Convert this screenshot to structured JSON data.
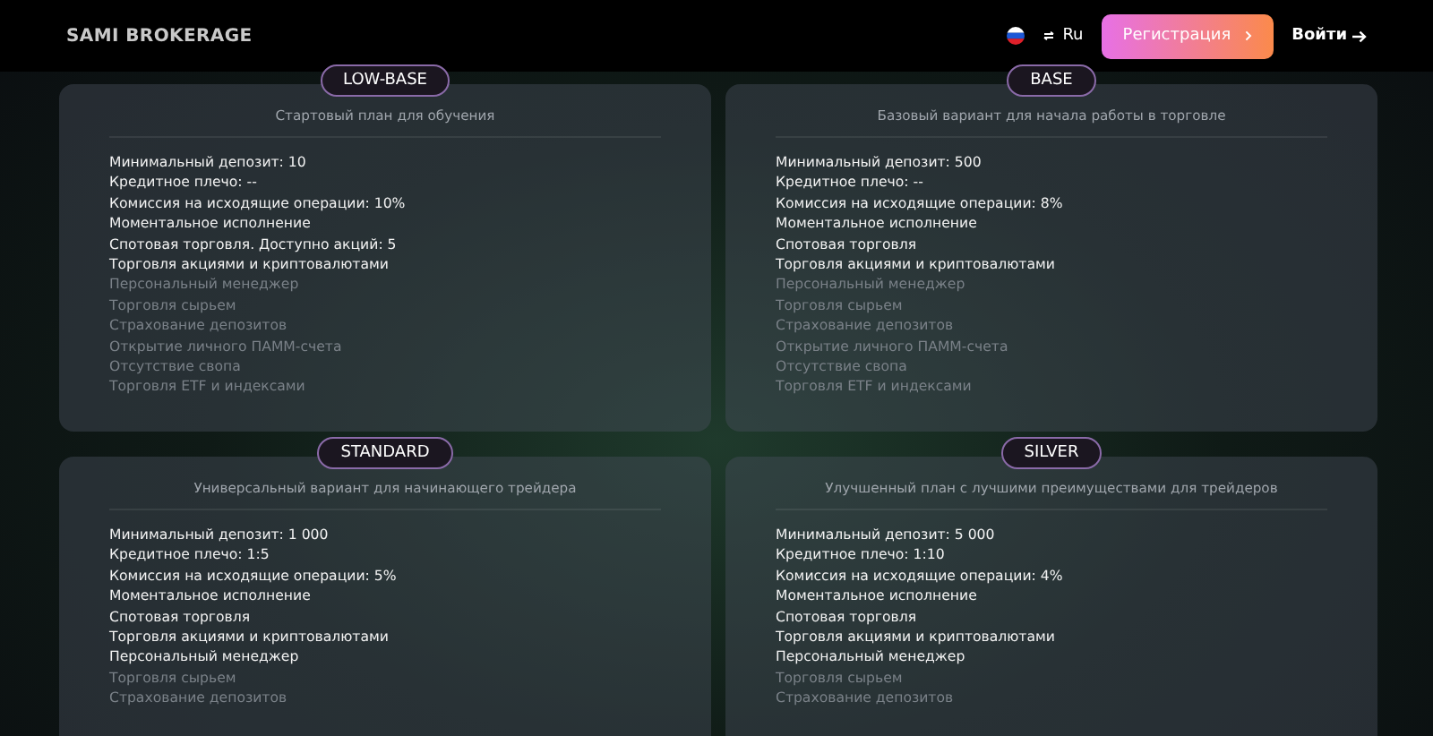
{
  "header": {
    "logo": "SAMI BROKERAGE",
    "language": "Ru",
    "register_button": "Регистрация",
    "login_link": "Войти"
  },
  "plans": [
    {
      "name": "LOW-BASE",
      "description": "Стартовый план для обучения",
      "features": [
        {
          "text": "Минимальный депозит: 10",
          "included": true
        },
        {
          "text": "Кредитное плечо: --",
          "included": true
        },
        {
          "text": "Комиссия на исходящие операции: 10%",
          "included": true
        },
        {
          "text": "Моментальное исполнение",
          "included": true
        },
        {
          "text": "Спотовая торговля. Доступно акций: 5",
          "included": true
        },
        {
          "text": "Торговля акциями и криптовалютами",
          "included": true
        },
        {
          "text": "Персональный менеджер",
          "included": false
        },
        {
          "text": "Торговля сырьем",
          "included": false
        },
        {
          "text": "Страхование депозитов",
          "included": false
        },
        {
          "text": "Открытие личного ПАММ-счета",
          "included": false
        },
        {
          "text": "Отсутствие свопа",
          "included": false
        },
        {
          "text": "Торговля ETF и индексами",
          "included": false
        }
      ]
    },
    {
      "name": "BASE",
      "description": "Базовый вариант для начала работы в торговле",
      "features": [
        {
          "text": "Минимальный депозит: 500",
          "included": true
        },
        {
          "text": "Кредитное плечо: --",
          "included": true
        },
        {
          "text": "Комиссия на исходящие операции: 8%",
          "included": true
        },
        {
          "text": "Моментальное исполнение",
          "included": true
        },
        {
          "text": "Спотовая торговля",
          "included": true
        },
        {
          "text": "Торговля акциями и криптовалютами",
          "included": true
        },
        {
          "text": "Персональный менеджер",
          "included": false
        },
        {
          "text": "Торговля сырьем",
          "included": false
        },
        {
          "text": "Страхование депозитов",
          "included": false
        },
        {
          "text": "Открытие личного ПАММ-счета",
          "included": false
        },
        {
          "text": "Отсутствие свопа",
          "included": false
        },
        {
          "text": "Торговля ETF и индексами",
          "included": false
        }
      ]
    },
    {
      "name": "STANDARD",
      "description": "Универсальный вариант для начинающего трейдера",
      "features": [
        {
          "text": "Минимальный депозит: 1 000",
          "included": true
        },
        {
          "text": "Кредитное плечо: 1:5",
          "included": true
        },
        {
          "text": "Комиссия на исходящие операции: 5%",
          "included": true
        },
        {
          "text": "Моментальное исполнение",
          "included": true
        },
        {
          "text": "Спотовая торговля",
          "included": true
        },
        {
          "text": "Торговля акциями и криптовалютами",
          "included": true
        },
        {
          "text": "Персональный менеджер",
          "included": true
        },
        {
          "text": "Торговля сырьем",
          "included": false
        },
        {
          "text": "Страхование депозитов",
          "included": false
        }
      ]
    },
    {
      "name": "SILVER",
      "description": "Улучшенный план с лучшими преимуществами для трейдеров",
      "features": [
        {
          "text": "Минимальный депозит: 5 000",
          "included": true
        },
        {
          "text": "Кредитное плечо: 1:10",
          "included": true
        },
        {
          "text": "Комиссия на исходящие операции: 4%",
          "included": true
        },
        {
          "text": "Моментальное исполнение",
          "included": true
        },
        {
          "text": "Спотовая торговля",
          "included": true
        },
        {
          "text": "Торговля акциями и криптовалютами",
          "included": true
        },
        {
          "text": "Персональный менеджер",
          "included": true
        },
        {
          "text": "Торговля сырьем",
          "included": false
        },
        {
          "text": "Страхование депозитов",
          "included": false
        }
      ]
    }
  ]
}
